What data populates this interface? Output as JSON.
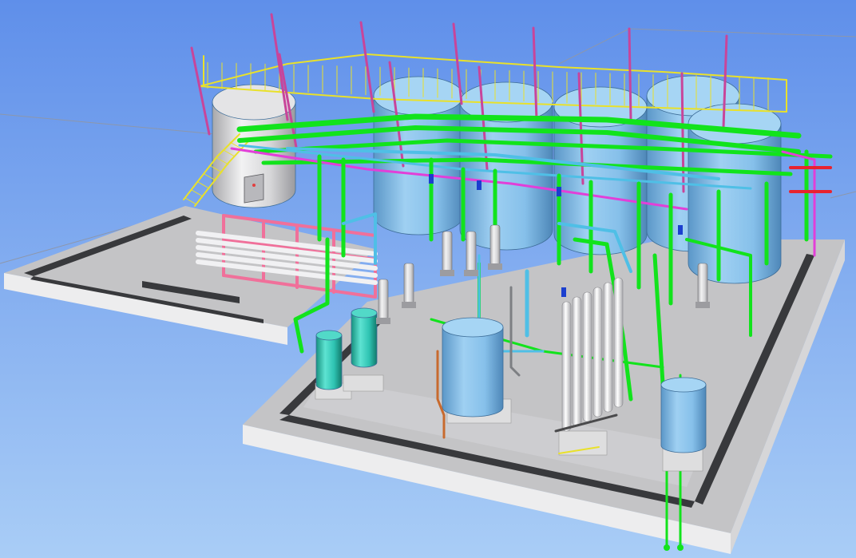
{
  "viewport": {
    "background_top": "#5f8fea",
    "background_bottom": "#a9cdf6"
  },
  "palette": {
    "slab_top": "#c4c4c6",
    "slab_front": "#ededee",
    "slab_side": "#d6d6d8",
    "trench": "#38393c",
    "tank_blue": "#86c0ea",
    "tank_blue_dark": "#5b97c8",
    "tank_grey": "#d8d8da",
    "tank_teal": "#2ec3b2",
    "pipe_green": "#12e31c",
    "pipe_cyan": "#4fbfe6",
    "pipe_magenta": "#e23fd8",
    "pipe_pink": "#f0709a",
    "frame_magenta": "#c8459a",
    "railing_yellow": "#e9e12a",
    "column_white": "#f1f1f3",
    "grid_line": "#8d97ab"
  },
  "equipment": [
    {
      "id": "storage-tank-grey",
      "kind": "tank",
      "color": "grey"
    },
    {
      "id": "storage-tank-1",
      "kind": "tank",
      "color": "blue"
    },
    {
      "id": "storage-tank-2",
      "kind": "tank",
      "color": "blue"
    },
    {
      "id": "storage-tank-3",
      "kind": "tank",
      "color": "blue"
    },
    {
      "id": "storage-tank-4",
      "kind": "tank",
      "color": "blue"
    },
    {
      "id": "storage-tank-5",
      "kind": "tank",
      "color": "blue"
    },
    {
      "id": "mixing-vessel",
      "kind": "vessel",
      "color": "blue"
    },
    {
      "id": "pressure-vessel",
      "kind": "vessel",
      "color": "blue"
    },
    {
      "id": "filter-vessel-1",
      "kind": "vessel",
      "color": "teal"
    },
    {
      "id": "filter-vessel-2",
      "kind": "vessel",
      "color": "teal"
    },
    {
      "id": "membrane-rack",
      "kind": "rack",
      "color": "white"
    },
    {
      "id": "ro-skid",
      "kind": "skid",
      "color": "pink"
    },
    {
      "id": "control-panel",
      "kind": "panel",
      "color": "grey"
    }
  ]
}
